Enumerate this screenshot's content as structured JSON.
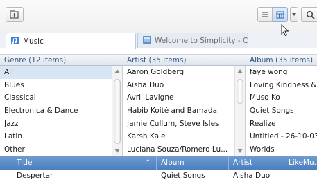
{
  "toolbar": {
    "add_icon": "add-to-playlist-icon",
    "list_view_icon": "list-view-icon",
    "grid_view_icon": "grid-view-icon",
    "dropdown_icon": "chevron-down-icon",
    "search_icon": "search-icon"
  },
  "tabs": [
    {
      "label": "Music",
      "icon": "music-note-icon",
      "active": true
    },
    {
      "label": "Welcome to Simplicity - Cou...",
      "icon": "webpage-icon",
      "close": "×",
      "active": false
    }
  ],
  "panes": {
    "genre": {
      "header": "Genre (12 items)",
      "items": [
        "All",
        "Blues",
        "Classical",
        "Electronica & Dance",
        "Jazz",
        "Latin",
        "Other"
      ],
      "selected_index": 0
    },
    "artist": {
      "header": "Artist (35 items)",
      "items": [
        "Aaron Goldberg",
        "Aisha Duo",
        "Avril Lavigne",
        "Habib Koité and Bamada",
        "Jamie Cullum, Steve Isles",
        "Karsh Kale",
        "Luciana Souza/Romero Lu..."
      ]
    },
    "album": {
      "header": "Album (35 items)",
      "items": [
        "faye wong",
        "Loving Kindness & \\",
        "Muso Ko",
        "Quiet Songs",
        "Realize",
        "Untitled - 26-10-03",
        "Worlds"
      ]
    }
  },
  "tracklist": {
    "columns": [
      {
        "label": "Title",
        "sort": "^"
      },
      {
        "label": "Album"
      },
      {
        "label": "Artist"
      },
      {
        "label": "LikeMu..."
      }
    ],
    "rows": [
      {
        "title": "Despertar",
        "album": "Quiet Songs",
        "artist": "Aisha Duo",
        "like": ""
      }
    ]
  },
  "colors": {
    "accent": "#4c7fbf",
    "header_text": "#355a86",
    "selection": "#d8e5f3"
  }
}
